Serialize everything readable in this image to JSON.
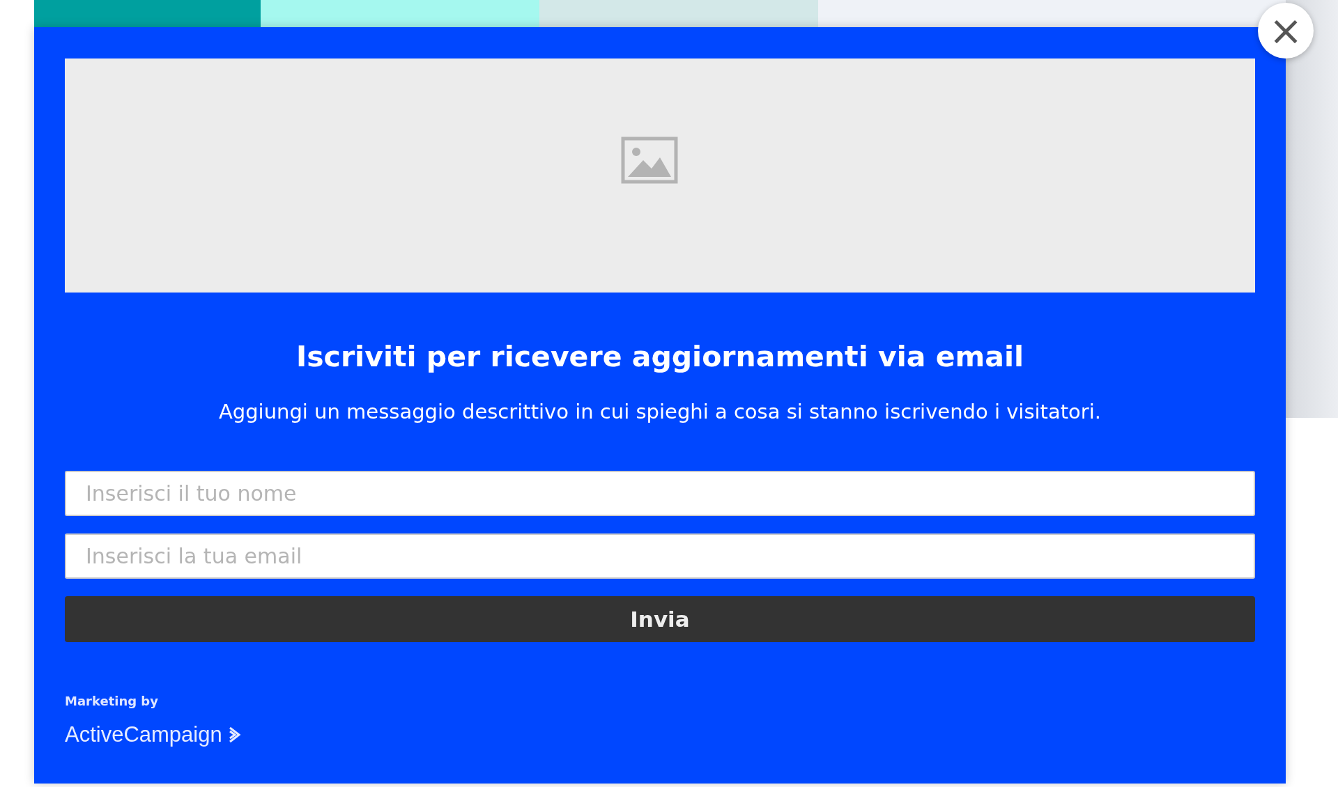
{
  "title": "Iscriviti per ricevere aggiornamenti via email",
  "description": "Aggiungi un messaggio descrittivo in cui spieghi a cosa si stanno iscrivendo i visitatori.",
  "fields": [
    {
      "placeholder": "Inserisci il tuo nome"
    },
    {
      "placeholder": "Inserisci la tua email"
    }
  ],
  "submit_button": "Invia",
  "footer": {
    "caption": "Marketing by",
    "brand": "ActiveCampaign"
  },
  "close_button": "×"
}
